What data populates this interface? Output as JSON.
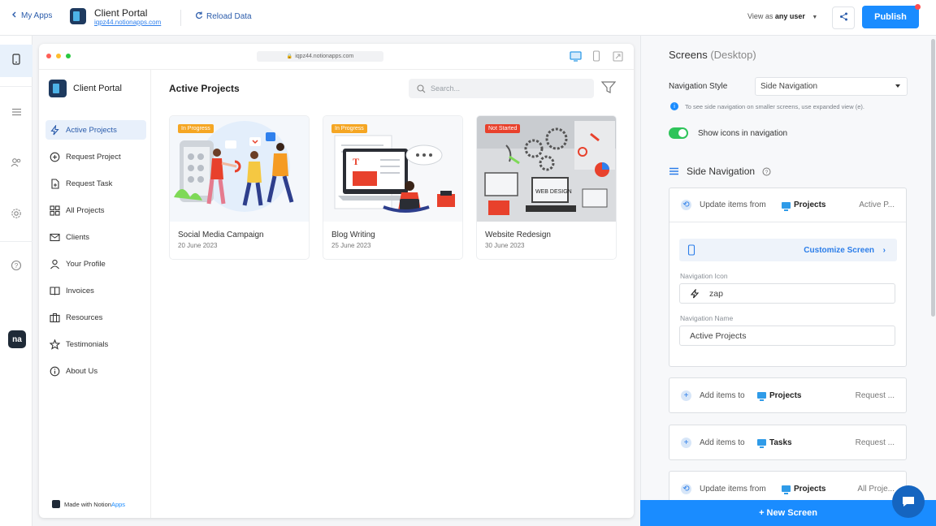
{
  "topbar": {
    "back_label": "My Apps",
    "app_title": "Client Portal",
    "app_url": "iqpz44.notionapps.com",
    "reload_label": "Reload Data",
    "view_as_prefix": "View as",
    "view_as_value": "any user",
    "publish_label": "Publish"
  },
  "rail": {
    "icons": [
      "mobile-icon",
      "list-icon",
      "users-icon",
      "gear-icon",
      "help-icon"
    ],
    "logo_text": "na"
  },
  "preview": {
    "url": "iqpz44.notionapps.com",
    "brand": "Client Portal",
    "nav": [
      {
        "label": "Active Projects",
        "icon": "zap-icon",
        "active": true
      },
      {
        "label": "Request Project",
        "icon": "plus-circle-icon"
      },
      {
        "label": "Request Task",
        "icon": "file-plus-icon"
      },
      {
        "label": "All Projects",
        "icon": "grid-icon"
      },
      {
        "label": "Clients",
        "icon": "mail-icon"
      },
      {
        "label": "Your Profile",
        "icon": "user-icon"
      },
      {
        "label": "Invoices",
        "icon": "book-icon"
      },
      {
        "label": "Resources",
        "icon": "briefcase-icon"
      },
      {
        "label": "Testimonials",
        "icon": "star-icon"
      },
      {
        "label": "About Us",
        "icon": "info-icon"
      }
    ],
    "made_with": "Made with Notion",
    "made_with_apps": "Apps",
    "page_title": "Active Projects",
    "search_placeholder": "Search...",
    "cards": [
      {
        "badge": "In Progress",
        "badge_color": "#f5a623",
        "title": "Social Media Campaign",
        "date": "20 June 2023"
      },
      {
        "badge": "In Progress",
        "badge_color": "#f5a623",
        "title": "Blog Writing",
        "date": "25 June 2023"
      },
      {
        "badge": "Not Started",
        "badge_color": "#e8412c",
        "title": "Website Redesign",
        "date": "30 June 2023"
      }
    ]
  },
  "panel": {
    "title": "Screens",
    "title_suffix": "(Desktop)",
    "nav_style_label": "Navigation Style",
    "nav_style_value": "Side Navigation",
    "info_text": "To see side navigation on smaller screens, use expanded view (e).",
    "toggle_label": "Show icons in navigation",
    "section_title": "Side Navigation",
    "block1": {
      "prefix": "Update items from",
      "db": "Projects",
      "right": "Active P..."
    },
    "customize_label": "Customize Screen",
    "nav_icon_label": "Navigation Icon",
    "nav_icon_value": "zap",
    "nav_name_label": "Navigation Name",
    "nav_name_value": "Active Projects",
    "block2": {
      "prefix": "Add items to",
      "db": "Projects",
      "right": "Request ..."
    },
    "block3": {
      "prefix": "Add items to",
      "db": "Tasks",
      "right": "Request ..."
    },
    "block4": {
      "prefix": "Update items from",
      "db": "Projects",
      "right": "All Proje..."
    },
    "new_screen_label": "+ New Screen"
  },
  "colors": {
    "accent": "#1a8cff",
    "toggle_on": "#2ec45a",
    "badge_in_progress": "#f5a623",
    "badge_not_started": "#e8412c"
  }
}
